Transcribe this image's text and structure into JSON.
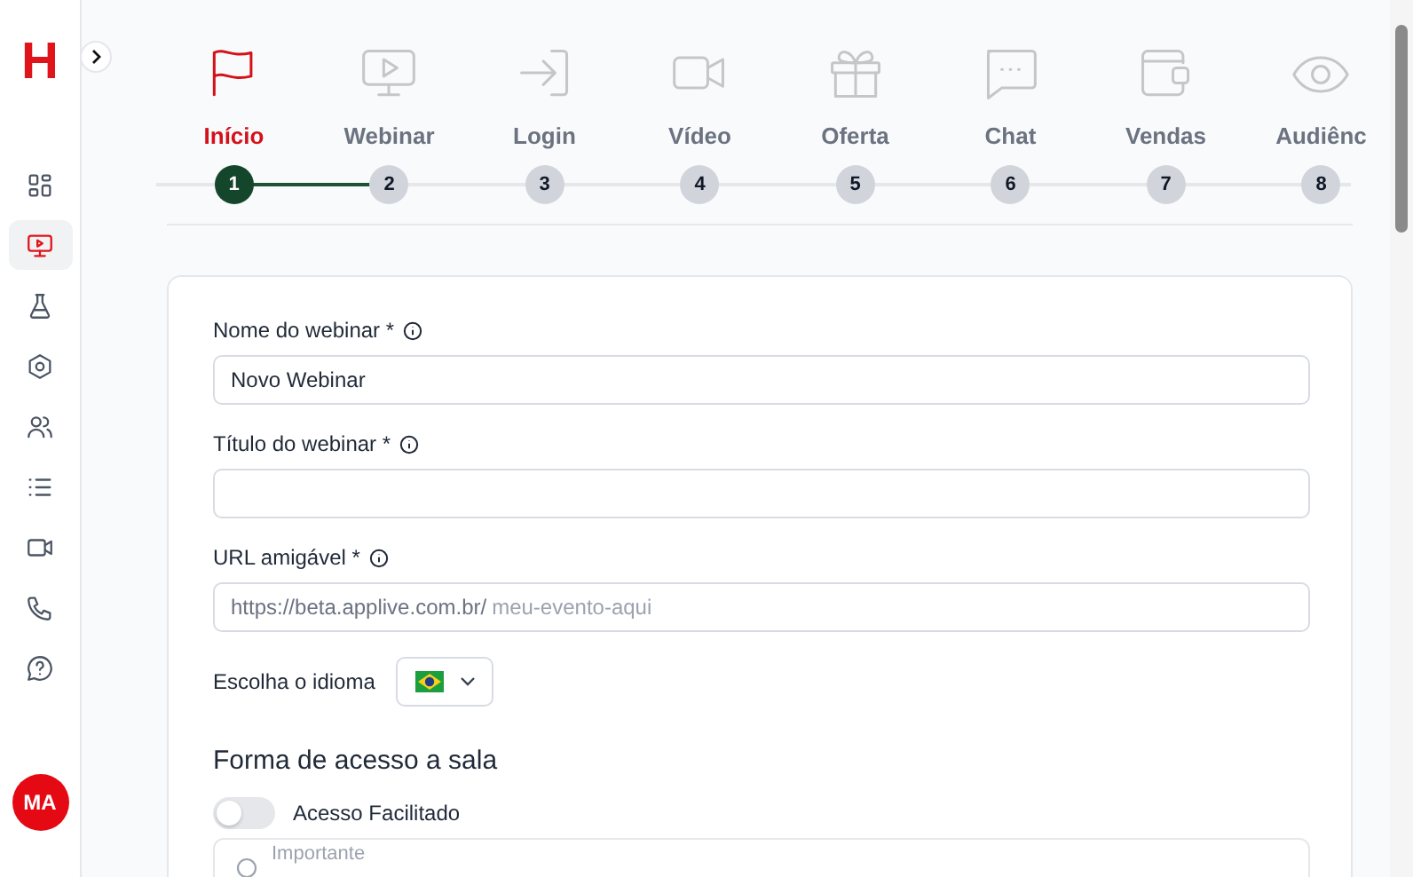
{
  "sidebar": {
    "logo": "H",
    "items": [
      {
        "kind": "dashboard",
        "selected": false
      },
      {
        "kind": "webinar",
        "selected": true
      },
      {
        "kind": "lab",
        "selected": false
      },
      {
        "kind": "hexagon",
        "selected": false
      },
      {
        "kind": "people",
        "selected": false
      },
      {
        "kind": "list",
        "selected": false
      },
      {
        "kind": "video",
        "selected": false
      },
      {
        "kind": "phone",
        "selected": false
      },
      {
        "kind": "help",
        "selected": false
      }
    ],
    "avatar": "MA"
  },
  "steps": [
    {
      "kind": "flag",
      "label": "Início",
      "number": "1",
      "selected": true
    },
    {
      "kind": "monitor",
      "label": "Webinar",
      "number": "2",
      "selected": false
    },
    {
      "kind": "login",
      "label": "Login",
      "number": "3",
      "selected": false
    },
    {
      "kind": "video",
      "label": "Vídeo",
      "number": "4",
      "selected": false
    },
    {
      "kind": "gift",
      "label": "Oferta",
      "number": "5",
      "selected": false
    },
    {
      "kind": "chat",
      "label": "Chat",
      "number": "6",
      "selected": false
    },
    {
      "kind": "wallet",
      "label": "Vendas",
      "number": "7",
      "selected": false
    },
    {
      "kind": "eye",
      "label": "Audiênc",
      "number": "8",
      "selected": false
    }
  ],
  "form": {
    "fields": [
      {
        "kind": "text",
        "label": "Nome do webinar *",
        "value": "Novo Webinar"
      },
      {
        "kind": "text",
        "label": "Título do webinar *"
      },
      {
        "kind": "url",
        "label": "URL amigável *",
        "prefix": "https://beta.applive.com.br/",
        "placeholder": "meu-evento-aqui"
      }
    ],
    "language": {
      "label": "Escolha o idioma"
    },
    "access_heading": "Forma de acesso a sala",
    "toggle": {
      "label": "Acesso Facilitado",
      "on": false
    },
    "notice": {
      "title": "Importante"
    }
  }
}
